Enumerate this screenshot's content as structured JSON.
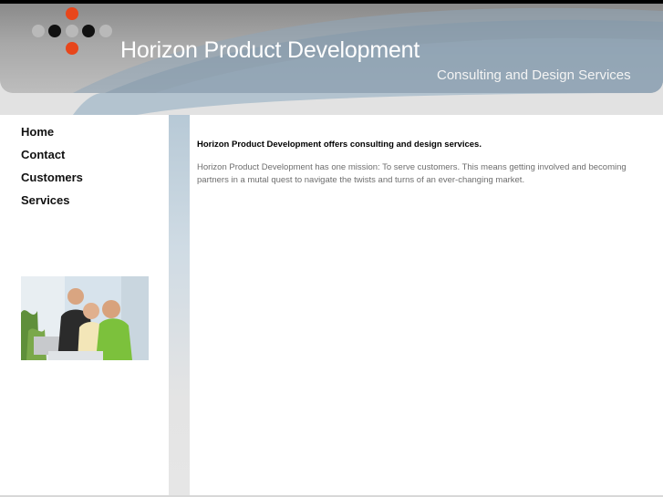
{
  "header": {
    "title": "Horizon Product Development",
    "tagline": "Consulting and Design Services",
    "logo_colors": {
      "orange": "#e8461b",
      "black": "#111111",
      "gray": "#b9b9b9"
    }
  },
  "nav": {
    "items": [
      {
        "label": "Home"
      },
      {
        "label": "Contact"
      },
      {
        "label": "Customers"
      },
      {
        "label": "Services"
      }
    ]
  },
  "content": {
    "heading": "Horizon Product Development offers consulting and design services.",
    "body": "Horizon Product Development has one mission:  To serve customers.  This means getting involved and becoming partners in a mutal quest to navigate the twists and turns of an ever-changing market."
  },
  "colors": {
    "accent_blue": "#7fa3bf",
    "header_gray": "#9c9c9c",
    "text_muted": "#6e6e6e"
  }
}
